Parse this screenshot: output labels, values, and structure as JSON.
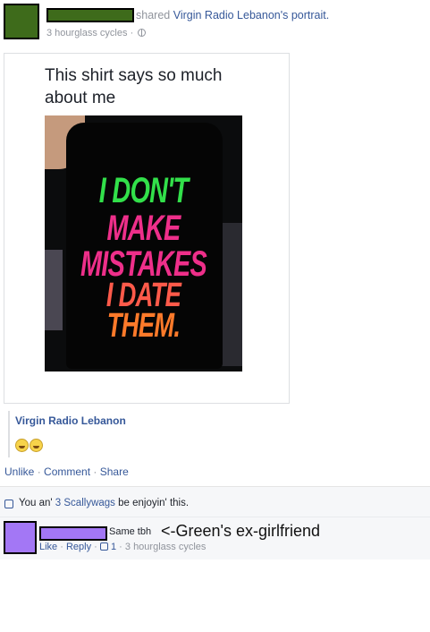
{
  "post": {
    "shared_text": "shared",
    "page_name": "Virgin Radio Lebanon",
    "portrait_suffix": "'s portrait.",
    "timestamp": "3 hourglass cycles",
    "separator": "·",
    "privacy_icon": "globe-icon"
  },
  "photo": {
    "caption": "This shirt says so much about me",
    "shirt_lines": [
      "I DON'T",
      "MAKE",
      "MISTAKES",
      "I DATE",
      "THEM."
    ]
  },
  "attribution": {
    "page_name": "Virgin Radio Lebanon",
    "emoji_icon": "grinning-face-icon"
  },
  "actions": {
    "unlike": "Unlike",
    "comment": "Comment",
    "share": "Share",
    "separator": "·"
  },
  "likes": {
    "prefix": "You an'",
    "others_link": "3 Scallywags",
    "suffix": "be enjoyin' this.",
    "icon": "thumbs-up-icon"
  },
  "comment": {
    "text": "Same tbh",
    "annotation": "<-Green's ex-girlfriend",
    "like": "Like",
    "reply": "Reply",
    "like_count": "1",
    "timestamp": "3 hourglass cycles",
    "separator": "·"
  },
  "colors": {
    "link": "#365899",
    "green_redaction": "#3e6b1b",
    "purple_redaction": "#a377f5"
  }
}
